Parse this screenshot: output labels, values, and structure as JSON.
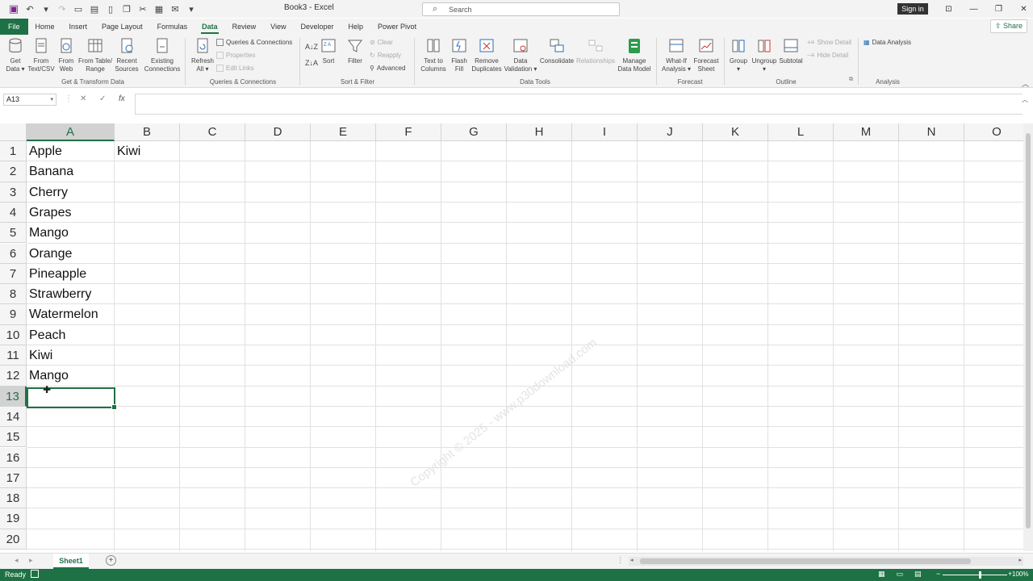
{
  "window": {
    "title": "Book3 - Excel",
    "search_placeholder": "Search",
    "signin": "Sign in",
    "share": "Share"
  },
  "tabs": [
    "File",
    "Home",
    "Insert",
    "Page Layout",
    "Formulas",
    "Data",
    "Review",
    "View",
    "Developer",
    "Help",
    "Power Pivot"
  ],
  "active_tab": "Data",
  "ribbon": {
    "get_data": "Get Data ▾",
    "from_text_csv": "From Text/CSV",
    "from_web": "From Web",
    "from_table_range": "From Table/ Range",
    "recent_sources": "Recent Sources",
    "existing_connections": "Existing Connections",
    "group_get_transform": "Get & Transform Data",
    "refresh_all": "Refresh All ▾",
    "queries_connections": "Queries & Connections",
    "properties": "Properties",
    "edit_links": "Edit Links",
    "group_queries": "Queries & Connections",
    "sort": "Sort",
    "filter": "Filter",
    "clear": "Clear",
    "reapply": "Reapply",
    "advanced": "Advanced",
    "group_sort_filter": "Sort & Filter",
    "text_to_columns": "Text to Columns",
    "flash_fill": "Flash Fill",
    "remove_duplicates": "Remove Duplicates",
    "data_validation": "Data Validation ▾",
    "consolidate": "Consolidate",
    "relationships": "Relationships",
    "manage_data_model": "Manage Data Model",
    "group_data_tools": "Data Tools",
    "what_if": "What-If Analysis ▾",
    "forecast_sheet": "Forecast Sheet",
    "group_forecast": "Forecast",
    "group_btn": "Group",
    "ungroup": "Ungroup",
    "subtotal": "Subtotal",
    "show_detail": "Show Detail",
    "hide_detail": "Hide Detail",
    "group_outline": "Outline",
    "data_analysis": "Data Analysis",
    "group_analysis": "Analysis"
  },
  "formula_bar": {
    "name_box": "A13",
    "cancel": "✕",
    "enter": "✓",
    "fx": "fx",
    "content": ""
  },
  "columns": [
    "A",
    "B",
    "C",
    "D",
    "E",
    "F",
    "G",
    "H",
    "I",
    "J",
    "K",
    "L",
    "M",
    "N",
    "O"
  ],
  "rows": [
    "1",
    "2",
    "3",
    "4",
    "5",
    "6",
    "7",
    "8",
    "9",
    "10",
    "11",
    "12",
    "13",
    "14",
    "15",
    "16",
    "17",
    "18",
    "19",
    "20"
  ],
  "cells": {
    "A1": "Apple",
    "A2": "Banana",
    "A3": "Cherry",
    "A4": "Grapes",
    "A5": "Mango",
    "A6": "Orange",
    "A7": "Pineapple",
    "A8": "Strawberry",
    "A9": "Watermelon",
    "A10": "Peach",
    "A11": "Kiwi",
    "A12": "Mango",
    "B1": "Kiwi"
  },
  "watermark": "Copyright © 2025 - www.p30download.com",
  "sheet_tab": "Sheet1",
  "status": {
    "ready": "Ready",
    "zoom": "100%"
  }
}
